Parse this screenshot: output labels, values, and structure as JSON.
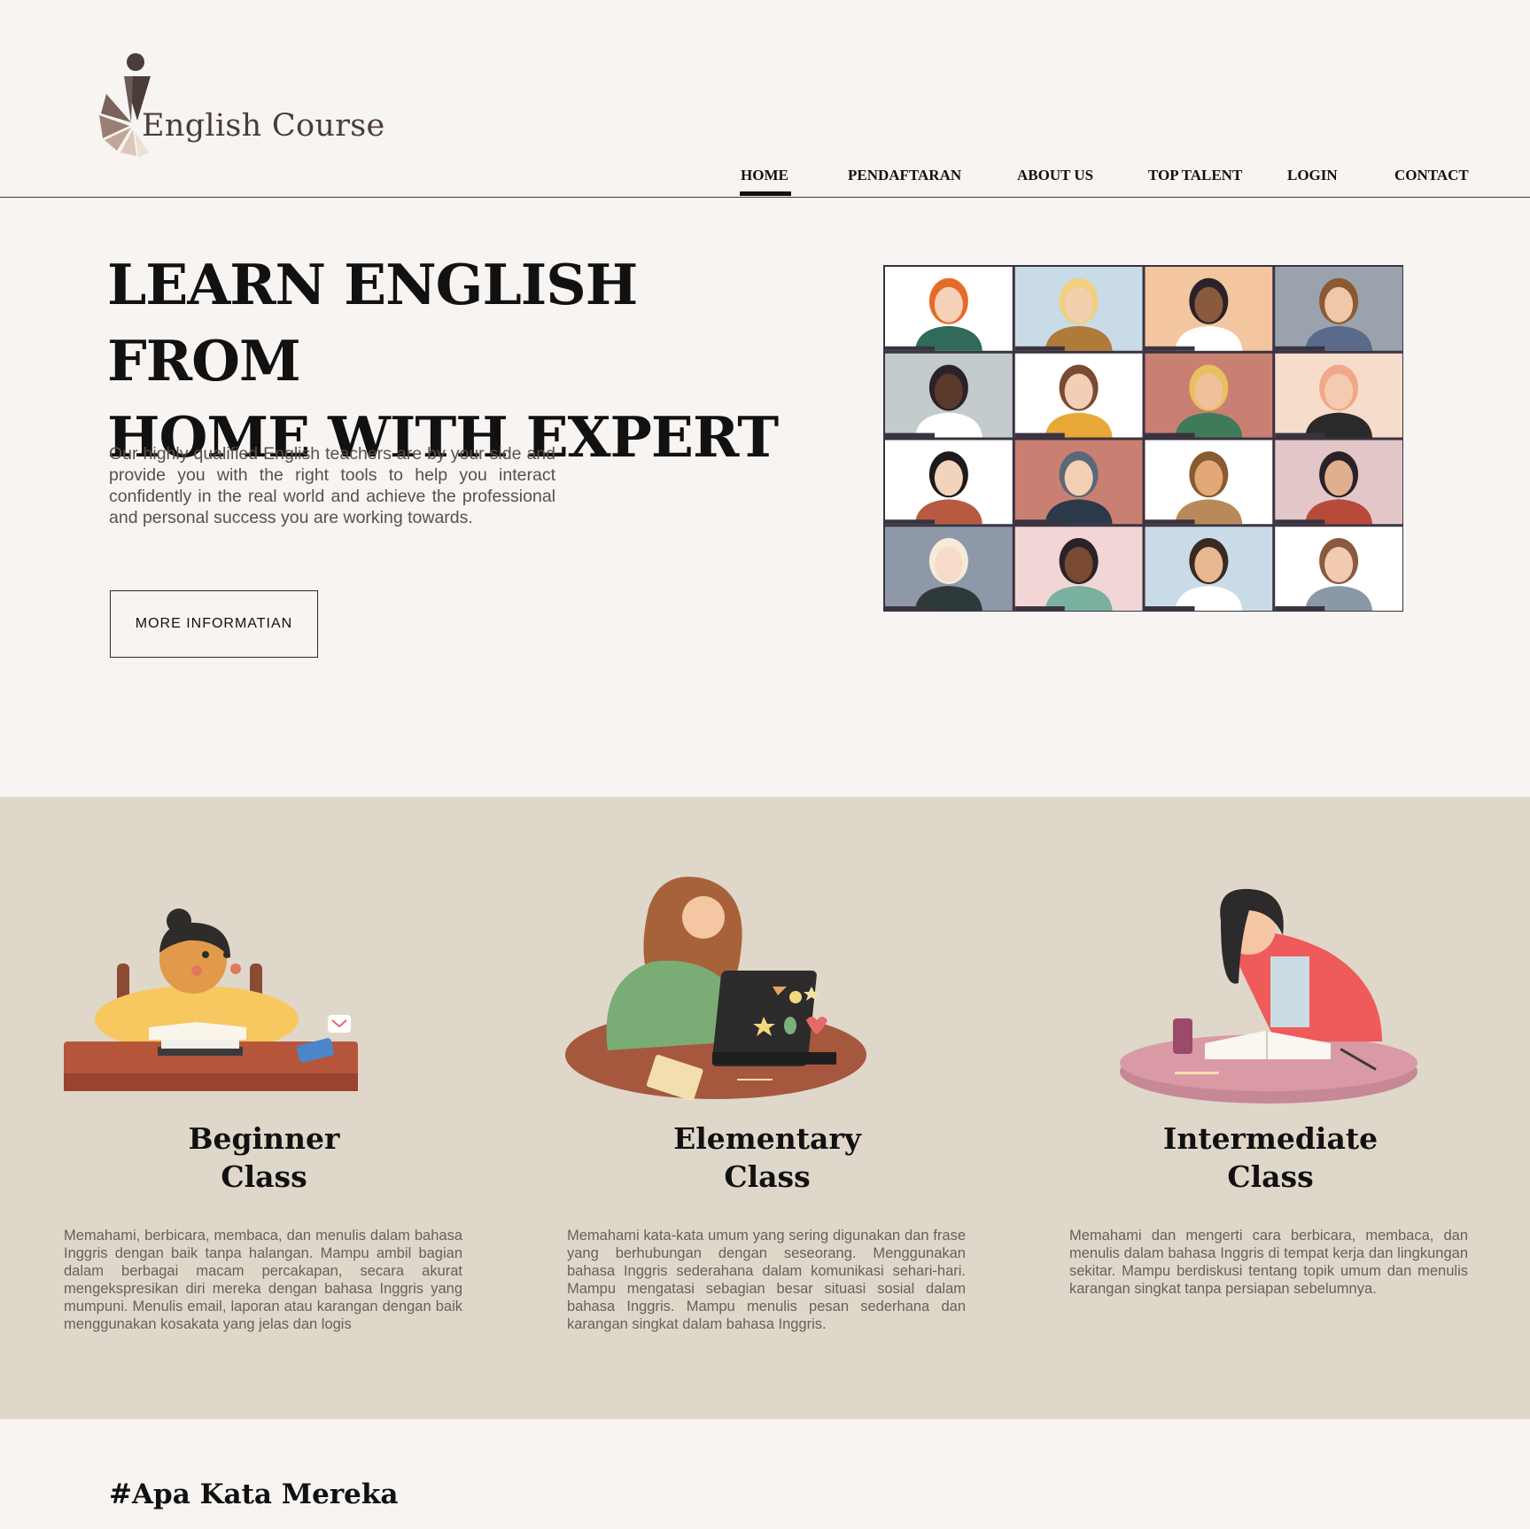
{
  "brand": {
    "name": "English Course"
  },
  "nav": {
    "items": [
      {
        "label": "HOME"
      },
      {
        "label": "PENDAFTARAN"
      },
      {
        "label": "ABOUT US"
      },
      {
        "label": "TOP TALENT"
      },
      {
        "label": "LOGIN"
      },
      {
        "label": "CONTACT"
      }
    ],
    "active": "HOME"
  },
  "hero": {
    "title_line1": "LEARN ENGLISH FROM",
    "title_line2": "HOME WITH EXPERT",
    "description": "Our highly qualified English teachers are by your side and provide you with the right tools to help you interact confidently in the real world and achieve the professional and personal success you are working towards.",
    "button_label": "MORE INFORMATIAN"
  },
  "classes": [
    {
      "title_line1": "Beginner",
      "title_line2": "Class",
      "description": "Memahami, berbicara, membaca, dan menulis dalam bahasa Inggris dengan baik tanpa halangan. Mampu ambil bagian dalam berbagai macam percakapan, secara akurat mengekspresikan diri mereka dengan bahasa Inggris yang mumpuni. Menulis email, laporan atau karangan dengan baik menggunakan kosakata yang jelas dan logis"
    },
    {
      "title_line1": "Elementary",
      "title_line2": "Class",
      "description": "Memahami kata-kata umum yang sering digunakan dan frase yang berhubungan dengan seseorang. Menggunakan bahasa Inggris sederahana dalam komunikasi sehari-hari. Mampu mengatasi sebagian besar situasi sosial dalam bahasa Inggris. Mampu menulis pesan sederhana dan karangan singkat dalam bahasa Inggris."
    },
    {
      "title_line1": "Intermediate",
      "title_line2": "Class",
      "description": "Memahami dan mengerti cara berbicara, membaca, dan menulis dalam bahasa Inggris di tempat kerja dan lingkungan sekitar. Mampu berdiskusi tentang topik umum dan menulis karangan singkat tanpa persiapan sebelumnya."
    }
  ],
  "testimonials": {
    "heading": "#Apa Kata Mereka"
  },
  "colors": {
    "page_bg": "#f7f4f2",
    "section_bg": "#dfd7c9",
    "text_dark": "#111111",
    "text_muted": "#6a5f5a",
    "logo_brown": "#4a3c38"
  }
}
